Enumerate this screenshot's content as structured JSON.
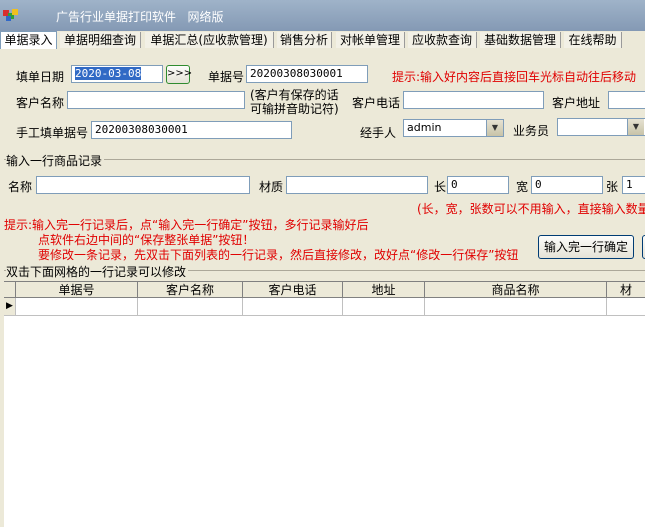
{
  "window": {
    "title": "广告行业单据打印软件",
    "edition": "网络版"
  },
  "tabs": [
    "单据录入",
    "单据明细查询",
    "单据汇总(应收款管理)",
    "销售分析",
    "对帐单管理",
    "应收款查询",
    "基础数据管理",
    "在线帮助"
  ],
  "header": {
    "date_label": "填单日期",
    "date_value": "2020-03-08",
    "date_button": ">>>",
    "order_no_label": "单据号",
    "order_no_value": "20200308030001",
    "hint": "提示:输入好内容后直接回车光标自动往后移动",
    "customer_name_label": "客户名称",
    "customer_name_value": "",
    "customer_note": "(客户有保存的话可输拼音助记符)",
    "customer_phone_label": "客户电话",
    "customer_phone_value": "",
    "customer_address_label": "客户地址",
    "customer_address_value": "",
    "manual_no_label": "手工填单据号",
    "manual_no_value": "20200308030001",
    "handler_label": "经手人",
    "handler_value": "admin",
    "salesman_label": "业务员",
    "salesman_value": ""
  },
  "item_entry": {
    "group_title": "输入一行商品记录",
    "name_label": "名称",
    "name_value": "",
    "material_label": "材质",
    "material_value": "",
    "length_label": "长",
    "length_value": "0",
    "width_label": "宽",
    "width_value": "0",
    "count_label": "张",
    "count_value": "1",
    "required_note": "(长，宽，张数可以不用输入，直接输入数量",
    "hint_line1": "提示:输入完一行记录后，点“输入完一行确定”按钮，多行记录输好后",
    "hint_line2": "点软件右边中间的“保存整张单据”按钮！",
    "hint_line3": "要修改一条记录，先双击下面列表的一行记录，然后直接修改，改好点“修改一行保存”按钮",
    "confirm_button": "输入完一行确定"
  },
  "grid": {
    "caption": "双击下面网格的一行记录可以修改",
    "columns": [
      "单据号",
      "客户名称",
      "客户电话",
      "地址",
      "商品名称",
      "材"
    ],
    "row_indicator": "▶"
  },
  "colors": {
    "titlebar": "#8fa4bf",
    "hint_red": "#e00000",
    "date_selected": "#316ac5"
  }
}
